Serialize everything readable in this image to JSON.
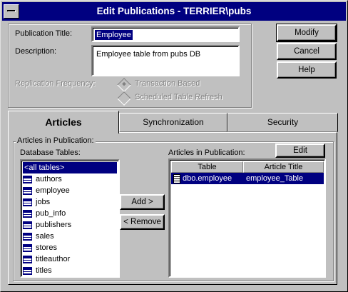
{
  "window": {
    "title": "Edit Publications - TERRIER\\pubs"
  },
  "publication": {
    "title_label": "Publication Title:",
    "title_value": "Employee",
    "description_label": "Description:",
    "description_value": "Employee table from pubs DB",
    "replication_label": "Replication Frequency:",
    "options": [
      {
        "label": "Transaction Based",
        "selected": true
      },
      {
        "label": "Scheduled Table Refresh",
        "selected": false
      }
    ]
  },
  "buttons": {
    "modify": "Modify",
    "cancel": "Cancel",
    "help": "Help"
  },
  "tabs": [
    "Articles",
    "Synchronization",
    "Security"
  ],
  "articles": {
    "group_label": "Articles in Publication:",
    "db_tables_label": "Database Tables:",
    "db_tables": [
      "<all tables>",
      "authors",
      "employee",
      "jobs",
      "pub_info",
      "publishers",
      "sales",
      "stores",
      "titleauthor",
      "titles"
    ],
    "add_button": "Add >",
    "remove_button": "< Remove",
    "edit_button": "Edit",
    "pub_articles_label": "Articles in Publication:",
    "columns": [
      "Table",
      "Article Title"
    ],
    "rows": [
      {
        "table": "dbo.employee",
        "title": "employee_Table"
      }
    ]
  },
  "colors": {
    "titlebar": "#000080",
    "face": "#c0c0c0",
    "selection": "#000080"
  }
}
